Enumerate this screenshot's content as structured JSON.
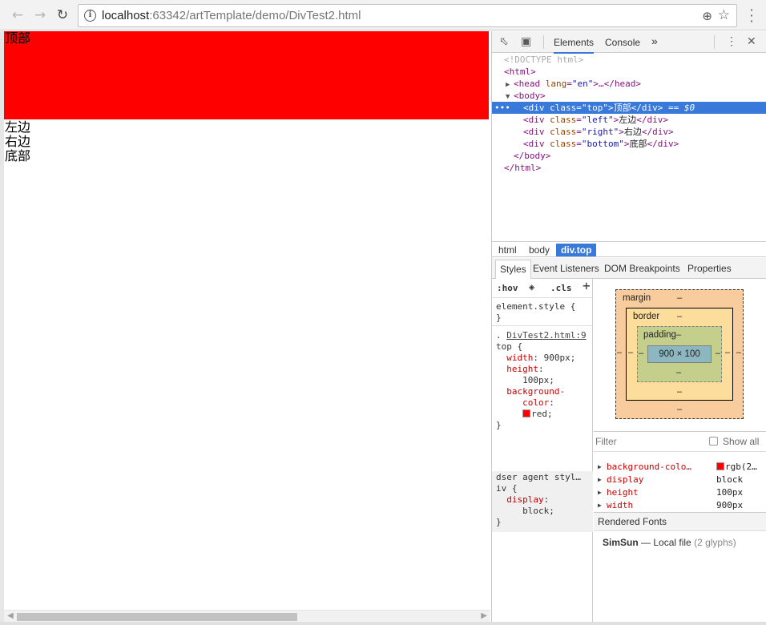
{
  "browser": {
    "url_host": "localhost",
    "url_path": ":63342/artTemplate/demo/DivTest2.html"
  },
  "page": {
    "top_text": "顶部",
    "left_text": "左边",
    "right_text": "右边",
    "bottom_text": "底部",
    "top_color": "#ff0000"
  },
  "devtools": {
    "tabs": {
      "elements": "Elements",
      "console": "Console",
      "more": "»"
    },
    "dom": {
      "doctype": "<!DOCTYPE html>",
      "html_open": "<html>",
      "head_tag": "<head",
      "head_attr": "lang",
      "head_val": "\"en\"",
      "head_rest": ">…</head>",
      "body_open": "<body>",
      "div_open": "<div",
      "div_class_attr": "class",
      "div_top_val": "\"top\"",
      "div_top_text": "顶部",
      "div_close": "</div>",
      "selected_marker": "== $0",
      "div_left_val": "\"left\"",
      "div_left_text": "左边",
      "div_right_val": "\"right\"",
      "div_right_text": "右边",
      "div_bottom_val": "\"bottom\"",
      "div_bottom_text": "底部",
      "body_close": "</body>",
      "html_close": "</html>",
      "ellipsis": "•••"
    },
    "breadcrumbs": [
      "html",
      "body",
      "div.top"
    ],
    "subtabs": [
      "Styles",
      "Event Listeners",
      "DOM Breakpoints",
      "Properties"
    ],
    "styles": {
      "hov": ":hov",
      "cls": ".cls",
      "plus": "+",
      "element_style": "element.style {",
      "close_brace": "}",
      "rule_source": "DivTest2.html:9",
      "rule_prefix": ".",
      "selector": "top {",
      "width_prop": "width",
      "width_val": "900px;",
      "height_prop": "height",
      "height_val": "100px;",
      "bg_prop_1": "background-",
      "bg_prop_2": "color",
      "bg_val": "red;",
      "ua_label": "dser agent styl…",
      "ua_selector": "iv {",
      "display_prop": "display",
      "display_val": "block;"
    },
    "boxmodel": {
      "margin_label": "margin",
      "border_label": "border",
      "padding_label": "padding",
      "content": "900 × 100",
      "dash": "–"
    },
    "computed": {
      "filter_placeholder": "Filter",
      "show_all": "Show all",
      "rows": [
        {
          "key": "background-colo…",
          "value": "rgb(2…"
        },
        {
          "key": "display",
          "value": "block"
        },
        {
          "key": "height",
          "value": "100px"
        },
        {
          "key": "width",
          "value": "900px"
        }
      ],
      "rendered_fonts": "Rendered Fonts",
      "font_name": "SimSun",
      "font_dash": "—",
      "font_source": "Local file",
      "font_glyphs": "(2 glyphs)"
    }
  }
}
